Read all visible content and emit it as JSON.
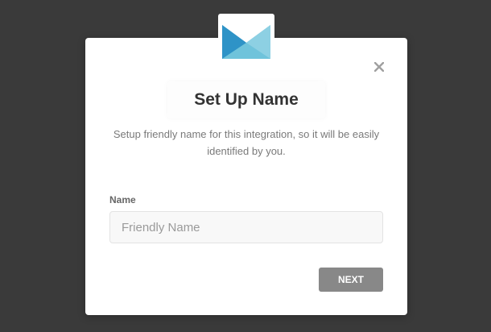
{
  "modal": {
    "logo_icon": "envelope-logo-icon",
    "logo_colors": {
      "dark": "#2e93c7",
      "light": "#6fc3db"
    },
    "close_icon": "close-icon",
    "title": "Set Up Name",
    "description": "Setup friendly name for this integration, so it will be easily identified by you.",
    "field": {
      "label": "Name",
      "placeholder": "Friendly Name",
      "value": ""
    },
    "next_button": "NEXT"
  },
  "colors": {
    "backdrop": "#3a3a3a",
    "button": "#888888",
    "title": "#333333"
  }
}
